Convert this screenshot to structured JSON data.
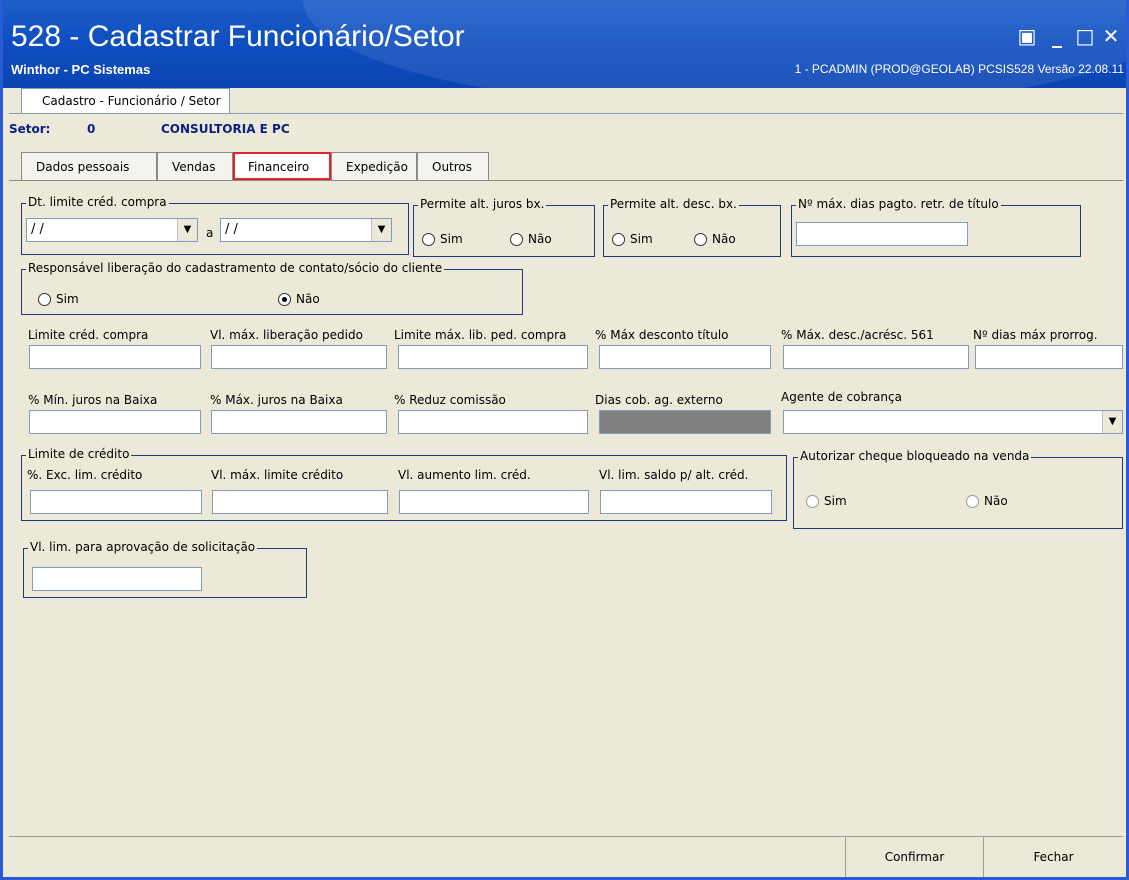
{
  "window": {
    "title": "528 - Cadastrar Funcionário/Setor",
    "subtitle": "Winthor - PC Sistemas",
    "session": "1 - PCADMIN (PROD@GEOLAB)  PCSIS528  Versão 22.08.11",
    "btn_restore": "▣",
    "btn_minimize": "_",
    "btn_maximize": "□",
    "btn_close": "✕"
  },
  "top_tab": "Cadastro - Funcionário / Setor",
  "setor": {
    "label": "Setor:",
    "code": "0",
    "name": "CONSULTORIA E PC"
  },
  "tabs": [
    "Dados pessoais",
    "Vendas",
    "Financeiro",
    "Expedição",
    "Outros"
  ],
  "form": {
    "dt_limite": {
      "title": "Dt. limite créd. compra",
      "from": " / /",
      "sep": "a",
      "to": " / /"
    },
    "juros": {
      "title": "Permite alt. juros bx.",
      "sim": "Sim",
      "nao": "Não"
    },
    "desc": {
      "title": "Permite alt. desc. bx.",
      "sim": "Sim",
      "nao": "Não"
    },
    "max_dias": {
      "title": "Nº máx. dias pagto. retr. de título",
      "value": ""
    },
    "responsavel": {
      "title": "Responsável liberação do cadastramento de contato/sócio do cliente",
      "sim": "Sim",
      "nao": "Não",
      "selected": "Não"
    },
    "row1": [
      "Limite créd. compra",
      "Vl. máx. liberação pedido",
      "Limite máx. lib. ped. compra",
      "% Máx desconto título",
      "% Máx. desc./acrésc. 561",
      "Nº dias máx prorrog."
    ],
    "row2": [
      "% Mín. juros na Baixa",
      "% Máx. juros na Baixa",
      "% Reduz  comissão",
      "Dias cob. ag. externo",
      "Agente de cobrança"
    ],
    "limite_credito": {
      "title": "Limite de crédito",
      "fields": [
        "%. Exc. lim. crédito",
        "Vl. máx. limite crédito",
        "Vl. aumento lim. créd.",
        "Vl. lim. saldo p/ alt. créd."
      ]
    },
    "cheque": {
      "title": "Autorizar cheque bloqueado na venda",
      "sim": "Sim",
      "nao": "Não"
    },
    "aprovacao": {
      "title": "Vl. lim. para aprovação de solicitação"
    }
  },
  "buttons": {
    "confirmar": "Confirmar",
    "fechar": "Fechar"
  },
  "colors": {
    "title_blue": "#0f4fc0",
    "panel": "#ece9d8",
    "highlight": "#e0272b",
    "setor_text": "#0a1f80"
  }
}
